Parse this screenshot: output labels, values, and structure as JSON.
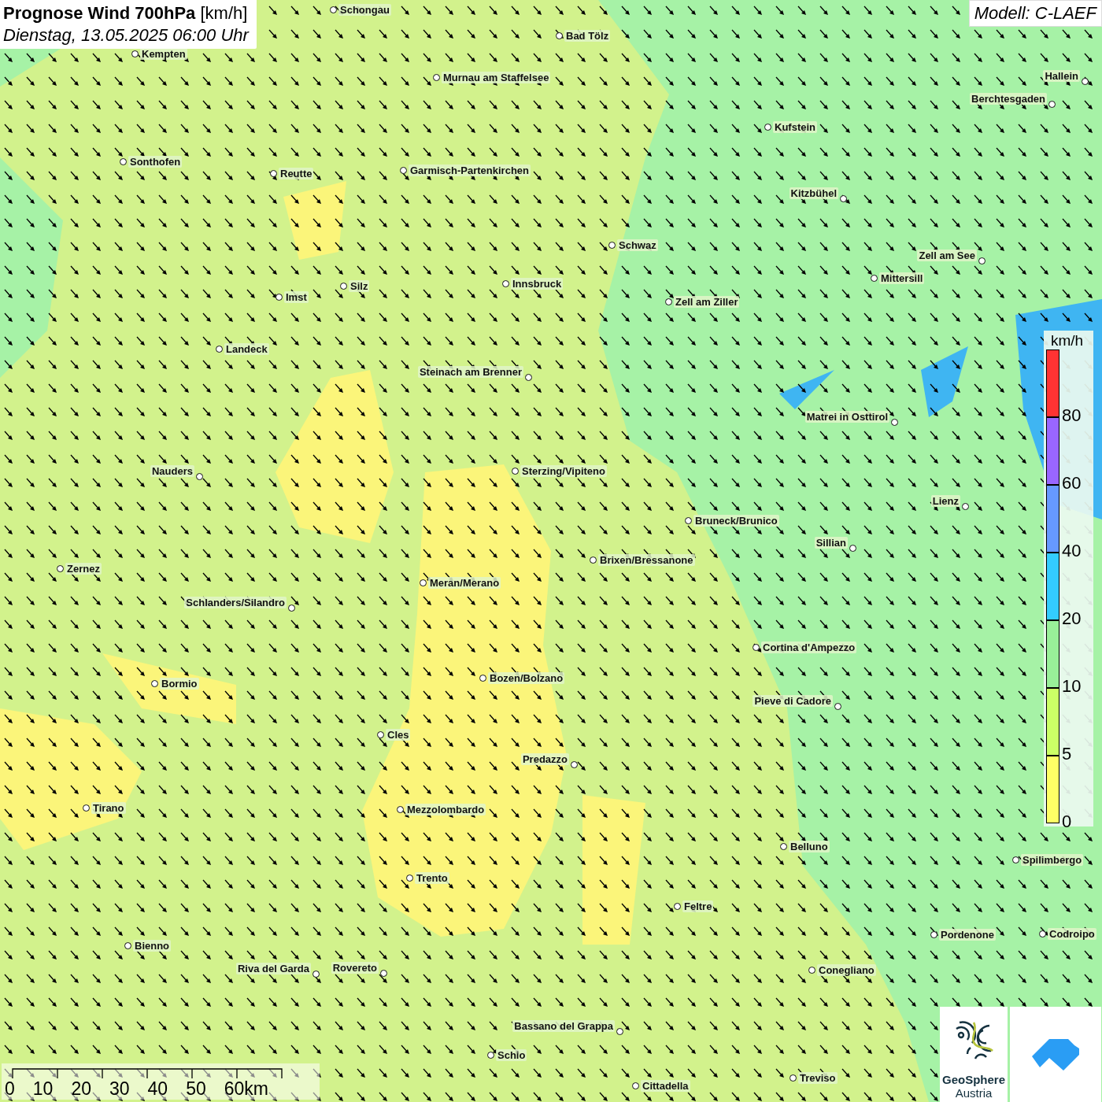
{
  "title": {
    "text": "Prognose Wind 700hPa",
    "unit": "[km/h]",
    "date": "Dienstag, 13.05.2025 06:00 Uhr"
  },
  "model": "Modell: C-LAEF",
  "places": [
    "Schongau",
    "Bad Tölz",
    "Kempten",
    "Murnau am Staffelsee",
    "Hallein",
    "Berchtesgaden",
    "Kufstein",
    "Sonthofen",
    "Reutte",
    "Garmisch-Partenkirchen",
    "Kitzbühel",
    "Schwaz",
    "Zell am See",
    "Innsbruck",
    "Silz",
    "Mittersill",
    "Imst",
    "Zell am Ziller",
    "Landeck",
    "Steinach am Brenner",
    "Matrei in Osttirol",
    "Nauders",
    "Sterzing/Vipiteno",
    "Lienz",
    "Bruneck/Brunico",
    "Sillian",
    "Brixen/Bressanone",
    "Zernez",
    "Meran/Merano",
    "Schlanders/Silandro",
    "Cortina d'Ampezzo",
    "Bozen/Bolzano",
    "Bormio",
    "Pieve di Cadore",
    "Cles",
    "Predazzo",
    "Tirano",
    "Mezzolombardo",
    "Belluno",
    "Spilimbergo",
    "Trento",
    "Feltre",
    "Pordenone",
    "Codroipo",
    "Bienno",
    "Riva del Garda",
    "Rovereto",
    "Conegliano",
    "Bassano del Grappa",
    "Schio",
    "Treviso",
    "Cittadella"
  ],
  "legend": {
    "unit": "km/h",
    "bins": [
      {
        "label": "80",
        "color": "#ff3333"
      },
      {
        "label": "60",
        "color": "#9966ff"
      },
      {
        "label": "40",
        "color": "#6699ff"
      },
      {
        "label": "20",
        "color": "#33ccff"
      },
      {
        "label": "10",
        "color": "#99f099"
      },
      {
        "label": "5",
        "color": "#ccff66"
      },
      {
        "label": "0",
        "color": "#ffff66"
      }
    ]
  },
  "scale_bar": [
    "0",
    "10",
    "20",
    "30",
    "40",
    "50",
    "60km"
  ],
  "logo": {
    "line1": "GeoSphere",
    "line2": "Austria"
  }
}
